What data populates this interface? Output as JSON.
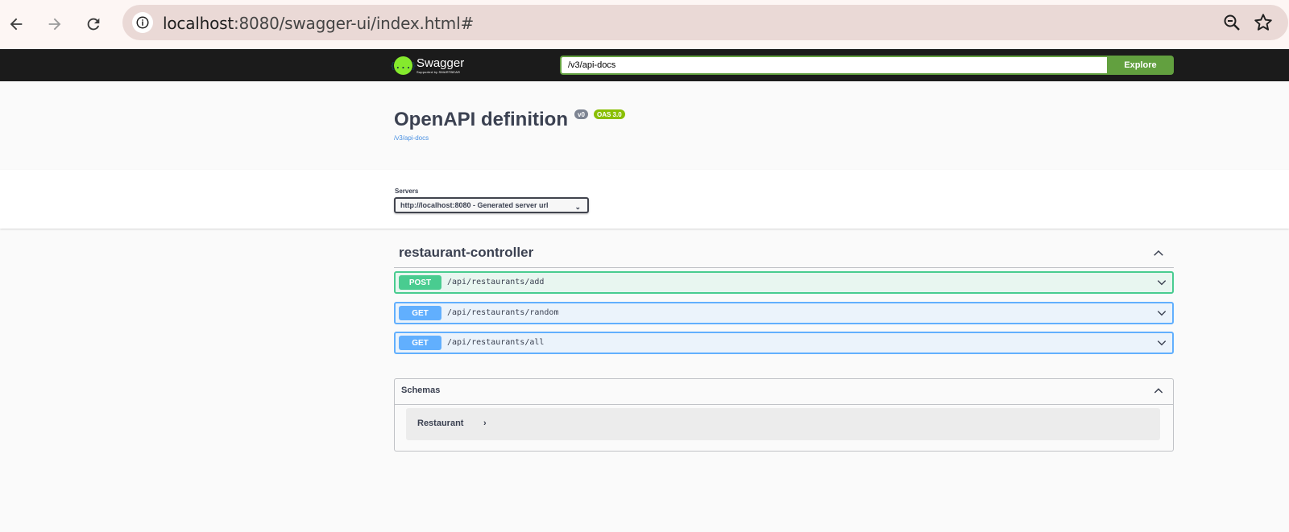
{
  "browser": {
    "url_host": "localhost",
    "url_rest": ":8080/swagger-ui/index.html#"
  },
  "topbar": {
    "logo_name": "Swagger",
    "logo_sub": "Supported by SMARTBEAR",
    "logo_mark": "{...}",
    "spec_url": "/v3/api-docs",
    "explore_label": "Explore"
  },
  "info": {
    "title": "OpenAPI definition",
    "version": "v0",
    "oas": "OAS 3.0",
    "link": "/v3/api-docs"
  },
  "servers": {
    "label": "Servers",
    "selected": "http://localhost:8080 - Generated server url"
  },
  "tag": {
    "name": "restaurant-controller"
  },
  "operations": [
    {
      "method": "POST",
      "path": "/api/restaurants/add"
    },
    {
      "method": "GET",
      "path": "/api/restaurants/random"
    },
    {
      "method": "GET",
      "path": "/api/restaurants/all"
    }
  ],
  "schemas": {
    "title": "Schemas",
    "models": [
      {
        "name": "Restaurant"
      }
    ]
  },
  "colors": {
    "post": "#49cc90",
    "get": "#61affe",
    "swagger_green": "#85ea2d",
    "explore": "#62a03f"
  }
}
